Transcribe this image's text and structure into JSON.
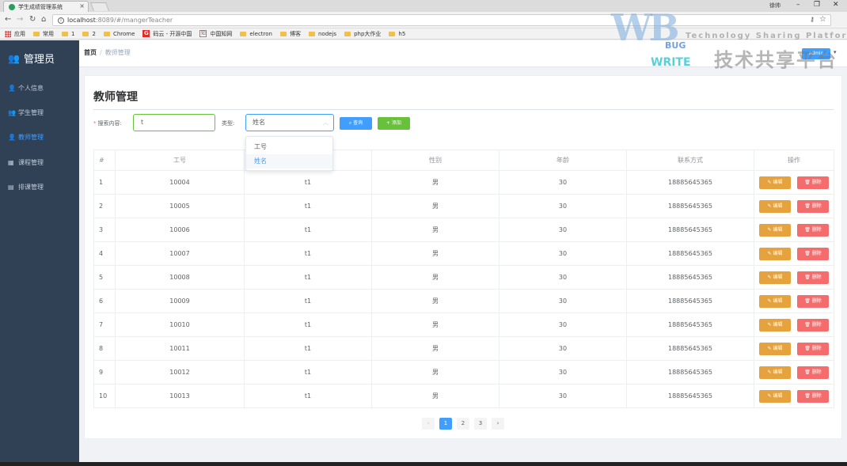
{
  "browser": {
    "tab_title": "学生成绩管理系统",
    "tab_close": "×",
    "user": "徐帅",
    "win_min": "–",
    "win_max": "❐",
    "win_close": "✕",
    "url_host": "localhost",
    "url_rest": ":8089/#/mangerTeacher",
    "bookmarks": [
      "应用",
      "常用",
      "1",
      "2",
      "Chrome",
      "码云 - 开源中国",
      "中国知网",
      "electron",
      "博客",
      "nodejs",
      "php大作业",
      "h5"
    ]
  },
  "sidebar": {
    "title": "管理员",
    "items": [
      {
        "label": "个人信息",
        "icon": "👤"
      },
      {
        "label": "学生管理",
        "icon": "👥"
      },
      {
        "label": "教师管理",
        "icon": "👤"
      },
      {
        "label": "课程管理",
        "icon": "▦"
      },
      {
        "label": "排课管理",
        "icon": "▤"
      }
    ]
  },
  "topbar": {
    "breadcrumb_home": "首页",
    "breadcrumb_sep": "/",
    "breadcrumb_current": "教师管理",
    "admin_label": "admin",
    "admin_caret": "▾"
  },
  "page": {
    "title": "教师管理",
    "search_label": "搜索内容:",
    "search_required": "*",
    "search_value": "t",
    "type_label": "类型:",
    "type_value": "姓名",
    "query_label": "查询",
    "add_label": "添加"
  },
  "dropdown": {
    "options": [
      "工号",
      "姓名"
    ],
    "selected": "姓名"
  },
  "table": {
    "headers": [
      "#",
      "工号",
      "",
      "性别",
      "年龄",
      "联系方式",
      "操作"
    ],
    "edit_label": "编辑",
    "delete_label": "删除",
    "rows": [
      [
        "1",
        "10004",
        "t1",
        "男",
        "30",
        "18885645365"
      ],
      [
        "2",
        "10005",
        "t1",
        "男",
        "30",
        "18885645365"
      ],
      [
        "3",
        "10006",
        "t1",
        "男",
        "30",
        "18885645365"
      ],
      [
        "4",
        "10007",
        "t1",
        "男",
        "30",
        "18885645365"
      ],
      [
        "5",
        "10008",
        "t1",
        "男",
        "30",
        "18885645365"
      ],
      [
        "6",
        "10009",
        "t1",
        "男",
        "30",
        "18885645365"
      ],
      [
        "7",
        "10010",
        "t1",
        "男",
        "30",
        "18885645365"
      ],
      [
        "8",
        "10011",
        "t1",
        "男",
        "30",
        "18885645365"
      ],
      [
        "9",
        "10012",
        "t1",
        "男",
        "30",
        "18885645365"
      ],
      [
        "10",
        "10013",
        "t1",
        "男",
        "30",
        "18885645365"
      ]
    ]
  },
  "pagination": {
    "prev": "‹",
    "pages": [
      "1",
      "2",
      "3"
    ],
    "current": "1",
    "next": "›"
  },
  "watermark": {
    "logo": "WB",
    "bug": "BUG",
    "write": "WRITE",
    "tagline": "Technology Sharing Platform",
    "zh": "技术共享平台"
  },
  "colors": {
    "sidebar": "#304156",
    "primary": "#409eff",
    "success": "#67c23a",
    "warning": "#e6a23c",
    "danger": "#f56c6c"
  }
}
